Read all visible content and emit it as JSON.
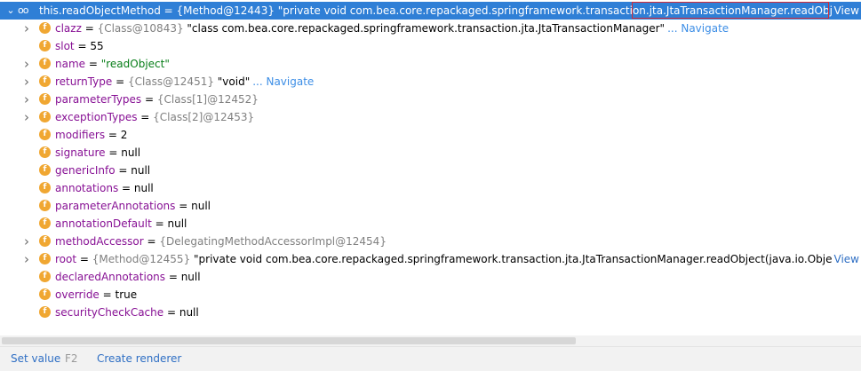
{
  "root": {
    "name": "this.readObjectMethod",
    "eq": " = ",
    "ref": "{Method@12443}",
    "value": " \"private void com.bea.core.repackaged.springframework.transaction.jta.JtaTransactionManager.readObject...",
    "view": "View"
  },
  "fields": [
    {
      "expandable": true,
      "name": "clazz",
      "ref": "{Class@10843}",
      "value": " \"class com.bea.core.repackaged.springframework.transaction.jta.JtaTransactionManager\"",
      "kind": "plainstr",
      "nav": "... Navigate"
    },
    {
      "expandable": false,
      "name": "slot",
      "ref": "",
      "value": "55",
      "kind": "num",
      "nav": ""
    },
    {
      "expandable": true,
      "name": "name",
      "ref": "",
      "value": "\"readObject\"",
      "kind": "str",
      "nav": ""
    },
    {
      "expandable": true,
      "name": "returnType",
      "ref": "{Class@12451}",
      "value": " \"void\"",
      "kind": "plainstr",
      "nav": "... Navigate"
    },
    {
      "expandable": true,
      "name": "parameterTypes",
      "ref": "{Class[1]@12452}",
      "value": "",
      "kind": "num",
      "nav": ""
    },
    {
      "expandable": true,
      "name": "exceptionTypes",
      "ref": "{Class[2]@12453}",
      "value": "",
      "kind": "num",
      "nav": ""
    },
    {
      "expandable": false,
      "name": "modifiers",
      "ref": "",
      "value": "2",
      "kind": "num",
      "nav": ""
    },
    {
      "expandable": false,
      "name": "signature",
      "ref": "",
      "value": "null",
      "kind": "num",
      "nav": ""
    },
    {
      "expandable": false,
      "name": "genericInfo",
      "ref": "",
      "value": "null",
      "kind": "num",
      "nav": ""
    },
    {
      "expandable": false,
      "name": "annotations",
      "ref": "",
      "value": "null",
      "kind": "num",
      "nav": ""
    },
    {
      "expandable": false,
      "name": "parameterAnnotations",
      "ref": "",
      "value": "null",
      "kind": "num",
      "nav": ""
    },
    {
      "expandable": false,
      "name": "annotationDefault",
      "ref": "",
      "value": "null",
      "kind": "num",
      "nav": ""
    },
    {
      "expandable": true,
      "name": "methodAccessor",
      "ref": "{DelegatingMethodAccessorImpl@12454}",
      "value": "",
      "kind": "num",
      "nav": ""
    },
    {
      "expandable": true,
      "name": "root",
      "ref": "{Method@12455}",
      "value": " \"private void com.bea.core.repackaged.springframework.transaction.jta.JtaTransactionManager.readObject(java.io.ObjectIr",
      "kind": "plainstr",
      "nav": "",
      "view": "View"
    },
    {
      "expandable": false,
      "name": "declaredAnnotations",
      "ref": "",
      "value": "null",
      "kind": "num",
      "nav": ""
    },
    {
      "expandable": false,
      "name": "override",
      "ref": "",
      "value": "true",
      "kind": "num",
      "nav": ""
    },
    {
      "expandable": false,
      "name": "securityCheckCache",
      "ref": "",
      "value": "null",
      "kind": "num",
      "nav": ""
    }
  ],
  "field_icon": "f",
  "eq": " = ",
  "footer": {
    "set_value": "Set value",
    "set_value_key": "F2",
    "create_renderer": "Create renderer"
  },
  "colors": {
    "selection": "#2f7fd6",
    "field_badge": "#f0a732",
    "link": "#2f6fc4",
    "highlight_box": "#d42a36"
  }
}
